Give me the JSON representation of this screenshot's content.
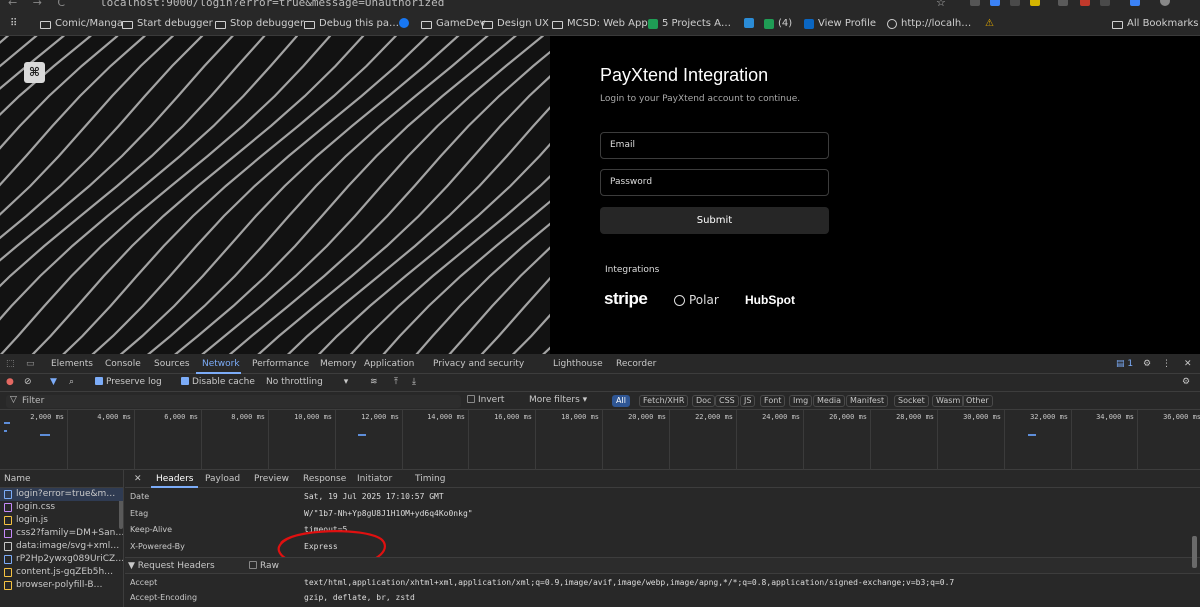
{
  "browser": {
    "url": "localhost:9000/login?error=true&message=Unauthorized",
    "star": "☆"
  },
  "bookmarks": {
    "apps": "⠿",
    "items": [
      "Comic/Manga",
      "Start debugger",
      "Stop debugger",
      "Debug this pa…",
      "",
      "GameDev",
      "Design UX",
      "MCSD: Web App…",
      "5 Projects A…",
      "(4)",
      "View Profile",
      "http://localh…"
    ],
    "all": "All Bookmarks"
  },
  "login": {
    "title": "PayXtend Integration",
    "subtitle": "Login to your PayXtend account to continue.",
    "email_placeholder": "Email",
    "password_placeholder": "Password",
    "submit": "Submit",
    "integrations_label": "Integrations",
    "brands": [
      "stripe",
      "Polar",
      "HubSpot"
    ]
  },
  "devtools": {
    "tabs": [
      "Elements",
      "Console",
      "Sources",
      "Network",
      "Performance",
      "Memory",
      "Application",
      "Privacy and security",
      "Lighthouse",
      "Recorder"
    ],
    "issues_count": "1",
    "toolbar": {
      "preserve_log": "Preserve log",
      "disable_cache": "Disable cache",
      "throttling": "No throttling"
    },
    "filter": {
      "placeholder": "Filter",
      "invert": "Invert",
      "more_filters": "More filters",
      "types": [
        "All",
        "Fetch/XHR",
        "Doc",
        "CSS",
        "JS",
        "Font",
        "Img",
        "Media",
        "Manifest",
        "Socket",
        "Wasm",
        "Other"
      ]
    },
    "timeline_ticks": [
      "2,000 ms",
      "4,000 ms",
      "6,000 ms",
      "8,000 ms",
      "10,000 ms",
      "12,000 ms",
      "14,000 ms",
      "16,000 ms",
      "18,000 ms",
      "20,000 ms",
      "22,000 ms",
      "24,000 ms",
      "26,000 ms",
      "28,000 ms",
      "30,000 ms",
      "32,000 ms",
      "34,000 ms",
      "36,000 ms"
    ],
    "name_header": "Name",
    "requests": [
      "login?error=true&m…",
      "login.css",
      "login.js",
      "css2?family=DM+San…",
      "data:image/svg+xml…",
      "rP2Hp2ywxg089UriCZ…",
      "content.js-gqZEb5h…",
      "browser-polyfill-B…"
    ],
    "detail_tabs": [
      "Headers",
      "Payload",
      "Preview",
      "Response",
      "Initiator",
      "Timing"
    ],
    "response_headers": [
      {
        "k": "Date",
        "v": "Sat, 19 Jul 2025 17:10:57 GMT"
      },
      {
        "k": "Etag",
        "v": "W/\"1b7-Nh+Yp8gU8J1H1OM+yd6q4Ko0nkg\""
      },
      {
        "k": "Keep-Alive",
        "v": "timeout=5"
      },
      {
        "k": "X-Powered-By",
        "v": "Express"
      }
    ],
    "request_section": "▼ Request Headers",
    "raw": "Raw",
    "request_headers": [
      {
        "k": "Accept",
        "v": "text/html,application/xhtml+xml,application/xml;q=0.9,image/avif,image/webp,image/apng,*/*;q=0.8,application/signed-exchange;v=b3;q=0.7"
      },
      {
        "k": "Accept-Encoding",
        "v": "gzip, deflate, br, zstd"
      }
    ]
  }
}
